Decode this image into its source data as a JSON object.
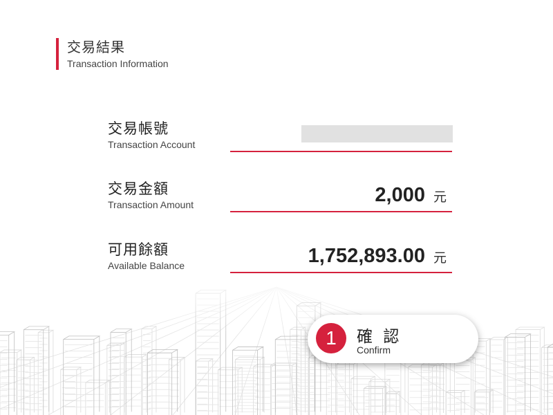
{
  "header": {
    "title_zh": "交易結果",
    "title_en": "Transaction Information"
  },
  "fields": [
    {
      "label_zh": "交易帳號",
      "label_en": "Transaction Account",
      "value": "",
      "unit": ""
    },
    {
      "label_zh": "交易金額",
      "label_en": "Transaction Amount",
      "value": "2,000",
      "unit": "元"
    },
    {
      "label_zh": "可用餘額",
      "label_en": "Available Balance",
      "value": "1,752,893.00",
      "unit": "元"
    }
  ],
  "confirm": {
    "number": "1",
    "label_zh": "確 認",
    "label_en": "Confirm"
  },
  "colors": {
    "accent": "#d5213d",
    "masked": "#e1e1e1"
  }
}
